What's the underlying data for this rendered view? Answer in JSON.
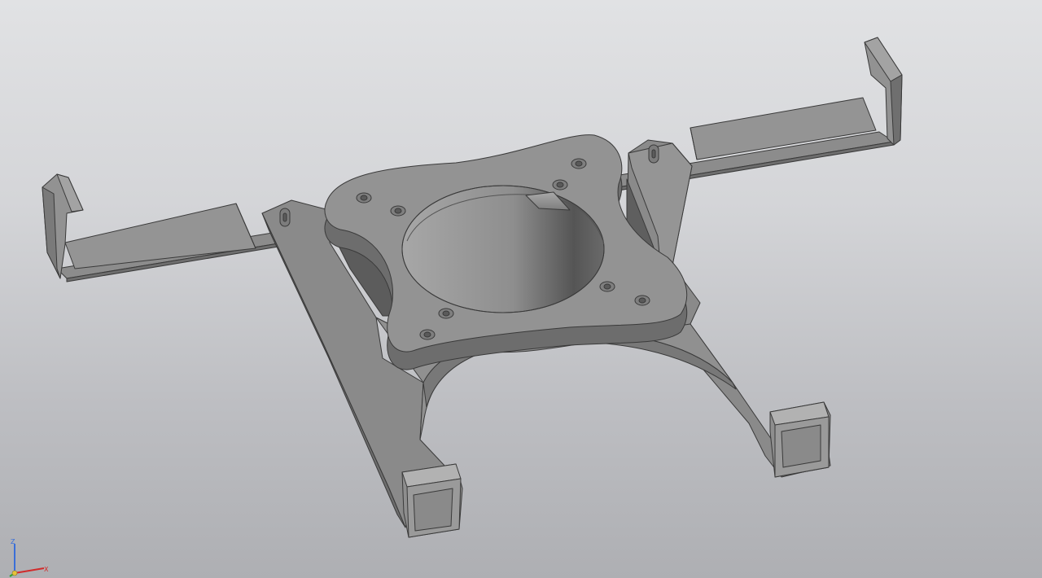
{
  "viewport": {
    "background_top": "#e1e2e4",
    "background_bottom": "#aeafb3",
    "model_color": "#8b8b8b",
    "edge_color": "#3a3a3a"
  },
  "triad": {
    "x_label": "X",
    "y_label": "Y",
    "z_label": "Z",
    "x_color": "#d12b2b",
    "y_color": "#2fa52f",
    "z_color": "#3a6fd8"
  }
}
